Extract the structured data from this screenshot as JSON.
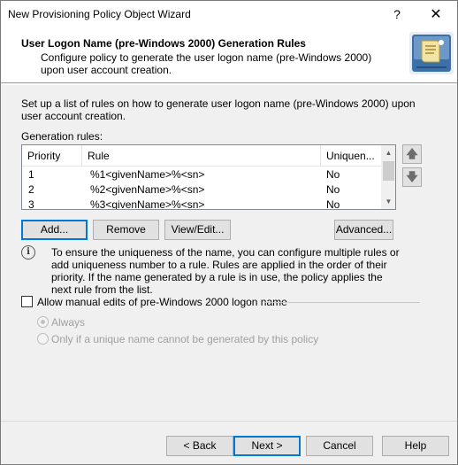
{
  "window": {
    "title": "New Provisioning Policy Object Wizard",
    "help_label": "?",
    "close_label": "✕"
  },
  "header": {
    "title": "User Logon Name (pre-Windows 2000) Generation Rules",
    "subtitle": "Configure policy to generate the user logon name (pre-Windows 2000) upon user account creation."
  },
  "body": {
    "description": "Set up a list of rules on how to generate user logon name (pre-Windows 2000) upon user account creation.",
    "rules_label": "Generation rules:"
  },
  "rules_table": {
    "columns": [
      "Priority",
      "Rule",
      "Uniquen..."
    ],
    "rows": [
      {
        "priority": "1",
        "rule": "%1<givenName>%<sn>",
        "unique": "No"
      },
      {
        "priority": "2",
        "rule": "%2<givenName>%<sn>",
        "unique": "No"
      },
      {
        "priority": "3",
        "rule": "%3<givenName>%<sn>",
        "unique": "No"
      }
    ]
  },
  "buttons": {
    "add": "Add...",
    "remove": "Remove",
    "view_edit": "View/Edit...",
    "advanced": "Advanced...",
    "move_up": "🡅",
    "move_down": "🡇"
  },
  "info": {
    "icon": "info-icon",
    "icon_glyph": "i",
    "text": "To ensure the uniqueness of the name, you can configure multiple rules or add uniqueness number to a rule. Rules are applied in the order of their priority. If the name generated by a rule is in use, the policy applies the next rule from the list."
  },
  "manual_edits": {
    "checkbox_label": "Allow manual edits of pre-Windows 2000 logon name",
    "checked": false,
    "option_always": "Always",
    "option_unique": "Only if a unique name cannot be generated by this policy",
    "selected": "Always"
  },
  "footer": {
    "back": "< Back",
    "next": "Next >",
    "cancel": "Cancel",
    "help": "Help"
  },
  "colors": {
    "accent": "#0078d7",
    "disabled_text": "#a0a0a0"
  }
}
